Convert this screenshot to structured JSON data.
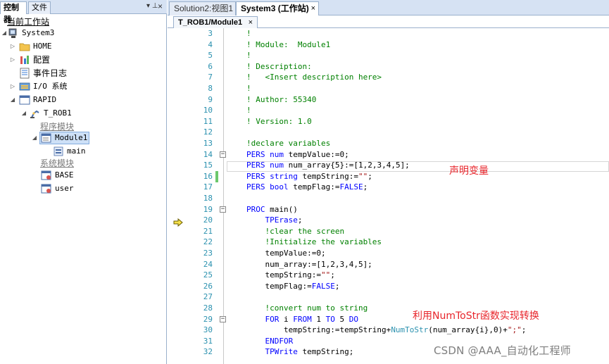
{
  "left_panel": {
    "tabs": [
      "控制器",
      "文件"
    ],
    "pin_glyph": "▾ ⊥",
    "close_glyph": "×",
    "tree": {
      "section_title": "当前工作站",
      "system": "System3",
      "home": "HOME",
      "config": "配置",
      "event_log": "事件日志",
      "io": "I/O 系统",
      "rapid": "RAPID",
      "task": "T_ROB1",
      "program_modules_label": "程序模块",
      "module": "Module1",
      "routine": "main",
      "system_modules_label": "系统模块",
      "sys_module_1": "BASE",
      "sys_module_2": "user"
    }
  },
  "doc_tabs": [
    {
      "label": "Solution2:视图1",
      "active": false
    },
    {
      "label": "System3 (工作站)",
      "active": true
    }
  ],
  "sub_tab": {
    "label": "T_ROB1/Module1"
  },
  "editor": {
    "lines": [
      {
        "n": "3",
        "code": "!"
      },
      {
        "n": "4",
        "code": "! Module:  Module1"
      },
      {
        "n": "5",
        "code": "!"
      },
      {
        "n": "6",
        "code": "! Description:"
      },
      {
        "n": "7",
        "code": "!   <Insert description here>"
      },
      {
        "n": "8",
        "code": "!"
      },
      {
        "n": "9",
        "code": "! Author: 55340"
      },
      {
        "n": "10",
        "code": "!"
      },
      {
        "n": "11",
        "code": "! Version: 1.0"
      },
      {
        "n": "12",
        "code": ""
      },
      {
        "n": "13",
        "code": "!declare variables"
      },
      {
        "n": "14",
        "code": "PERS num tempValue:=0;"
      },
      {
        "n": "15",
        "code": "PERS num num_array{5}:=[1,2,3,4,5];"
      },
      {
        "n": "16",
        "code": "PERS string tempString:=\"\";"
      },
      {
        "n": "17",
        "code": "PERS bool tempFlag:=FALSE;"
      },
      {
        "n": "18",
        "code": ""
      },
      {
        "n": "19",
        "code": "PROC main()"
      },
      {
        "n": "20",
        "code": "    TPErase;"
      },
      {
        "n": "21",
        "code": "    !clear the screen"
      },
      {
        "n": "22",
        "code": "    !Initialize the variables"
      },
      {
        "n": "23",
        "code": "    tempValue:=0;"
      },
      {
        "n": "24",
        "code": "    num_array:=[1,2,3,4,5];"
      },
      {
        "n": "25",
        "code": "    tempString:=\"\";"
      },
      {
        "n": "26",
        "code": "    tempFlag:=FALSE;"
      },
      {
        "n": "27",
        "code": ""
      },
      {
        "n": "28",
        "code": "    !convert num to string"
      },
      {
        "n": "29",
        "code": "    FOR i FROM 1 TO 5 DO"
      },
      {
        "n": "30",
        "code": "        tempString:=tempString+NumToStr(num_array{i},0)+\";\";"
      },
      {
        "n": "31",
        "code": "    ENDFOR"
      },
      {
        "n": "32",
        "code": "    TPWrite tempString;"
      }
    ],
    "fold_markers": [
      "14",
      "19",
      "29"
    ]
  },
  "annotations": {
    "declare": "声明变量",
    "convert": "利用NumToStr函数实现转换"
  },
  "watermark": "CSDN @AAA_自动化工程师",
  "colors": {
    "keyword": "#0000ff",
    "comment": "#008000",
    "annotation": "#e8252b",
    "line_number": "#2b91af"
  }
}
